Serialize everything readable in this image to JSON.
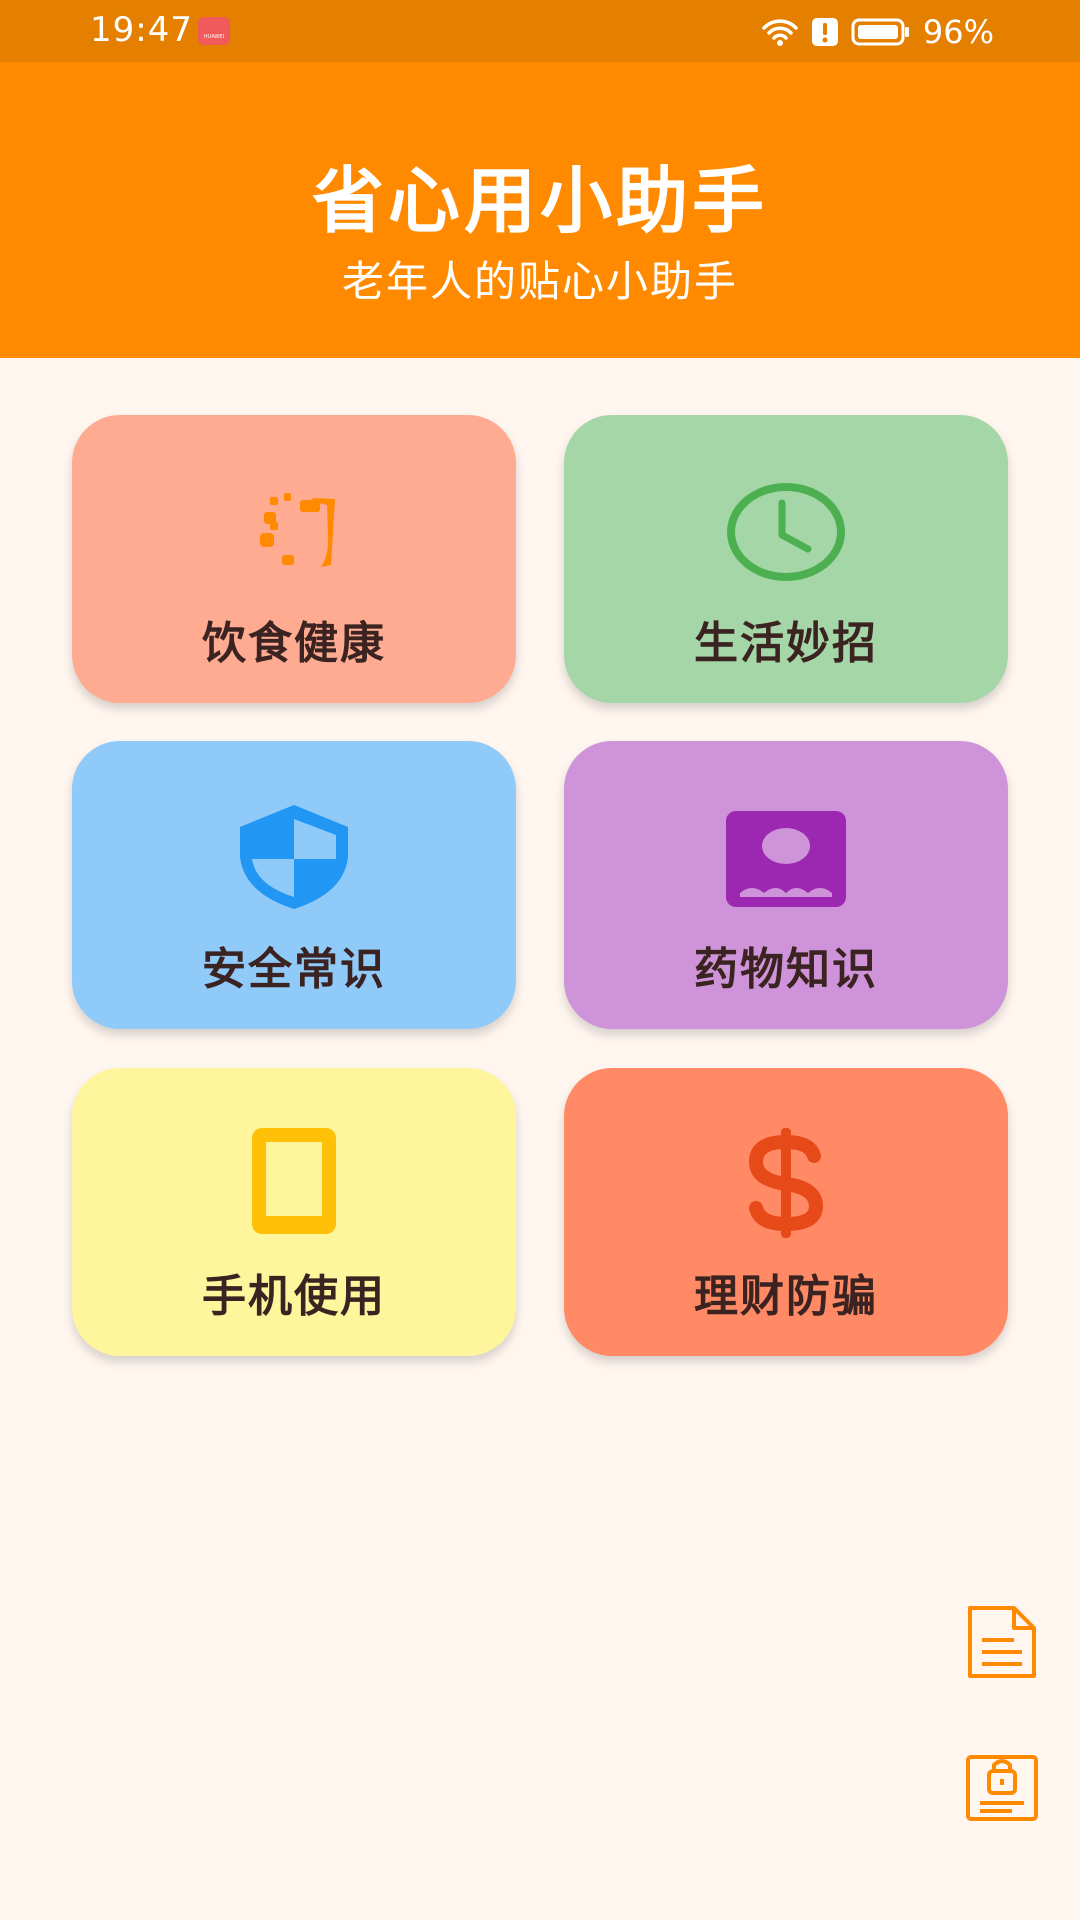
{
  "status_bar": {
    "time": "19:47",
    "app_badge_text": "HUAWEI",
    "battery": "96%"
  },
  "header": {
    "title": "省心用小助手",
    "subtitle": "老年人的贴心小助手",
    "background": "#FF8A00"
  },
  "cards": [
    {
      "label": "饮食健康",
      "icon": "food-icon",
      "background": "#FFAB91",
      "icon_color": "#FF8A00"
    },
    {
      "label": "生活妙招",
      "icon": "clock-icon",
      "background": "#A5D6A7",
      "icon_color": "#4CAF50"
    },
    {
      "label": "安全常识",
      "icon": "shield-icon",
      "background": "#90CAF9",
      "icon_color": "#2196F3"
    },
    {
      "label": "药物知识",
      "icon": "medicine-icon",
      "background": "#CE93D8",
      "icon_color": "#9C27B0"
    },
    {
      "label": "手机使用",
      "icon": "phone-icon",
      "background": "#FFF59D",
      "icon_color": "#FFC107"
    },
    {
      "label": "理财防骗",
      "icon": "dollar-icon",
      "background": "#FF8A65",
      "icon_color": "#E64A19"
    }
  ],
  "floating_buttons": [
    {
      "icon": "document-icon"
    },
    {
      "icon": "lock-screen-icon"
    }
  ]
}
